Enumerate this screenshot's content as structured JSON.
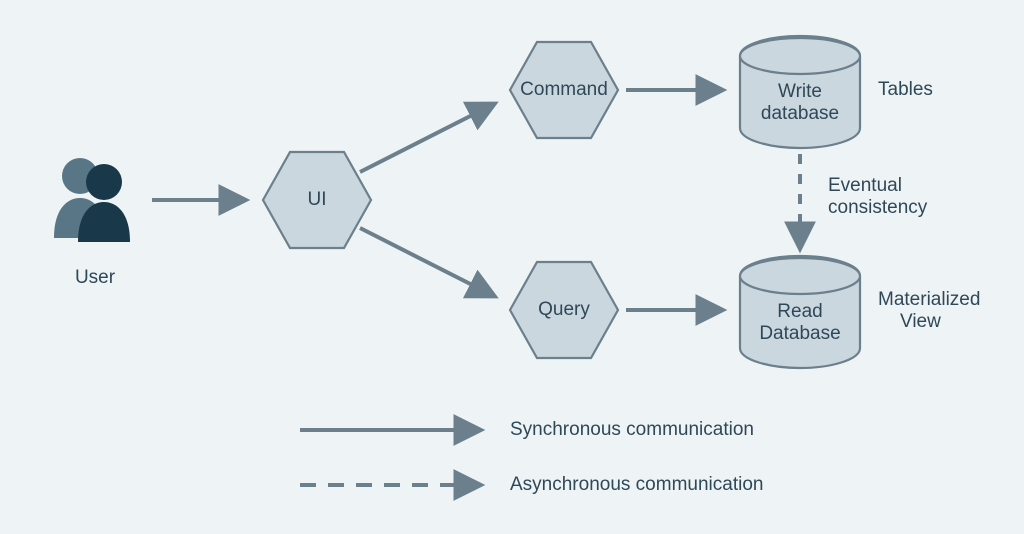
{
  "nodes": {
    "user": "User",
    "ui": "UI",
    "command": "Command",
    "query": "Query",
    "write_db": {
      "line1": "Write",
      "line2": "database"
    },
    "read_db": {
      "line1": "Read",
      "line2": "Database"
    }
  },
  "labels": {
    "tables": "Tables",
    "materialized": {
      "line1": "Materialized",
      "line2": "View"
    },
    "eventual": {
      "line1": "Eventual",
      "line2": "consistency"
    }
  },
  "legend": {
    "sync": "Synchronous communication",
    "async": "Asynchronous communication"
  },
  "colors": {
    "bg": "#eef3f5",
    "shape_fill": "#cbd7df",
    "shape_stroke": "#6b7f8c",
    "arrow": "#6b7f8c",
    "text": "#2f4858",
    "user_back": "#587686",
    "user_front": "#19384a"
  }
}
